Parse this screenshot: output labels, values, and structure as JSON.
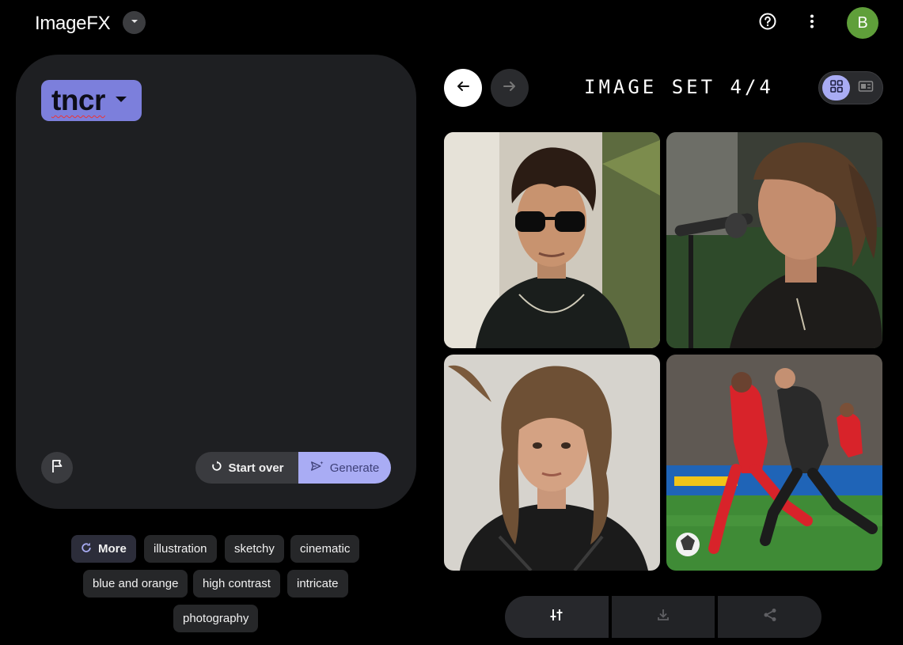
{
  "app": {
    "title": "ImageFX",
    "avatar_letter": "B"
  },
  "icons": {
    "app_switch": "caret-down-icon",
    "help": "help-icon",
    "menu": "more-vert-icon",
    "flag": "flag-icon",
    "start_over": "refresh-icon",
    "generate": "send-sparkle-icon",
    "more": "refresh-icon",
    "prev": "arrow-left-icon",
    "next": "arrow-right-icon",
    "grid_view": "grid-icon",
    "single_view": "single-view-icon",
    "edit": "tune-icon",
    "download": "download-icon",
    "share": "share-icon"
  },
  "prompt": {
    "text": "tncr"
  },
  "actions": {
    "start_over": "Start over",
    "generate": "Generate"
  },
  "chips": {
    "more": "More",
    "items": [
      "illustration",
      "sketchy",
      "cinematic",
      "blue and orange",
      "high contrast",
      "intricate",
      "photography"
    ]
  },
  "image_set": {
    "label": "IMAGE SET 4/4"
  },
  "colors": {
    "accent": "#a9acf4",
    "chip_accent": "#7c7fdc",
    "panel": "#1e1f22",
    "avatar": "#5f9f3a"
  }
}
